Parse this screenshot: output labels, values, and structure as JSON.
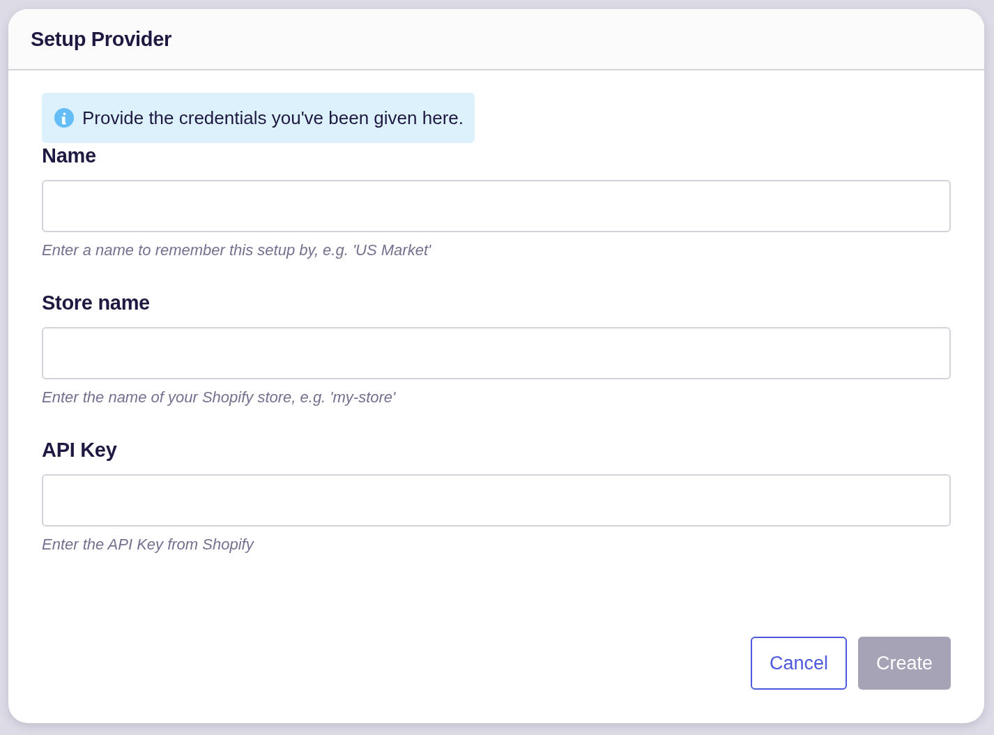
{
  "dialog": {
    "title": "Setup Provider",
    "info": {
      "text": "Provide the credentials you've been given here."
    },
    "fields": [
      {
        "label": "Name",
        "hint": "Enter a name to remember this setup by, e.g. 'US Market'"
      },
      {
        "label": "Store name",
        "hint": "Enter the name of your Shopify store, e.g. 'my-store'"
      },
      {
        "label": "API Key",
        "hint": "Enter the API Key from Shopify"
      }
    ],
    "buttons": [
      {
        "label": "Cancel",
        "kind": "secondary",
        "disabled": false
      },
      {
        "label": "Create",
        "kind": "primary",
        "disabled": true
      }
    ]
  }
}
